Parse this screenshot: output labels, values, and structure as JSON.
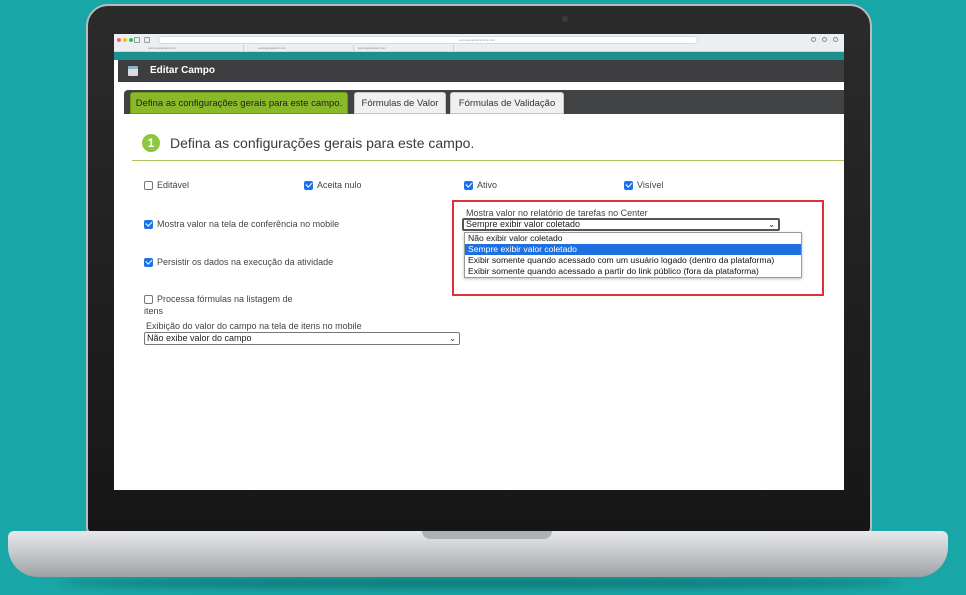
{
  "browser": {
    "url": "www.gestaofacilonline.com",
    "tabs": [
      "www.gestaofacil.com",
      "www.gestaofacil.com",
      "www.gestaofacil.com"
    ]
  },
  "modal": {
    "title": "Editar Campo"
  },
  "tabs": [
    {
      "label": "Defina as configurações gerais para este campo.",
      "active": true
    },
    {
      "label": "Fórmulas de Valor",
      "active": false
    },
    {
      "label": "Fórmulas de Validação",
      "active": false
    }
  ],
  "section": {
    "number": "1",
    "title": "Defina as configurações gerais para este campo."
  },
  "checkboxes": {
    "editavel": {
      "label": "Editável",
      "checked": false
    },
    "aceita_nulo": {
      "label": "Aceita nulo",
      "checked": true
    },
    "ativo": {
      "label": "Ativo",
      "checked": true
    },
    "visivel": {
      "label": "Visível",
      "checked": true
    },
    "mostra_valor_mobile": {
      "label": "Mostra valor na tela de conferência no mobile",
      "checked": true
    },
    "persistir_dados": {
      "label": "Persistir os dados na execução da atividade",
      "checked": true
    },
    "processa_formulas_line1": "Processa fórmulas na listagem de",
    "processa_formulas_line2": "itens",
    "processa_formulas_checked": false
  },
  "mobile_items": {
    "label": "Exibição do valor do campo na tela de itens no mobile",
    "value": "Não exibe valor do campo"
  },
  "relatorio": {
    "label": "Mostra valor no relatório de tarefas no Center",
    "value": "Sempre exibir valor coletado",
    "options": [
      "Não exibir valor coletado",
      "Sempre exibir valor coletado",
      "Exibir somente quando acessado com um usuário logado (dentro da plataforma)",
      "Exibir somente quando acessado a partir do link público (fora da plataforma)"
    ],
    "selected_index": 1
  },
  "colors": {
    "accent_green": "#89b928",
    "highlight_red": "#e0303a",
    "background_teal": "#18a7a6",
    "selection_blue": "#1e6fe0"
  }
}
